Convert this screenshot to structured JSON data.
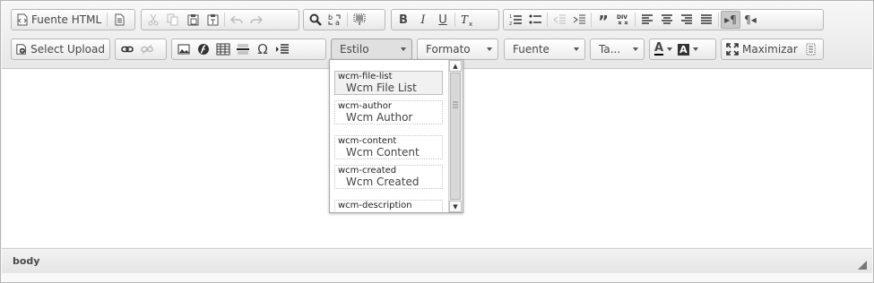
{
  "toolbar": {
    "source_label": "Fuente HTML",
    "select_upload_label": "Select Upload",
    "maximize_label": "Maximizar",
    "combos": {
      "styles": "Estilo",
      "format": "Formato",
      "font": "Fuente",
      "size": "Ta..."
    }
  },
  "styles_panel": {
    "items": [
      {
        "tag": "wcm-file-list",
        "name": "Wcm File List",
        "selected": true
      },
      {
        "tag": "wcm-author",
        "name": "Wcm Author",
        "selected": false
      },
      {
        "tag": "wcm-content",
        "name": "Wcm Content",
        "selected": false
      },
      {
        "tag": "wcm-created",
        "name": "Wcm Created",
        "selected": false
      },
      {
        "tag": "wcm-description",
        "name": "",
        "selected": false
      }
    ]
  },
  "footer": {
    "path": "body"
  },
  "colors": {
    "toolbar_bg": "#ebebeb",
    "border": "#b6b6b6",
    "icon": "#474747",
    "disabled_icon": "#bdbdbd"
  }
}
